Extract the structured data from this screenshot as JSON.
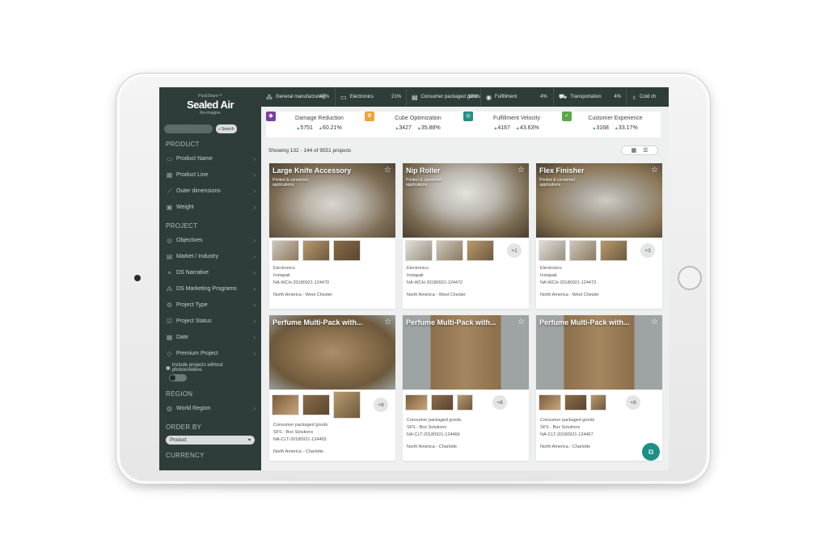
{
  "sidebar": {
    "logo_top": "PackShare™",
    "logo_brand": "Sealed Air",
    "logo_sub": "Re-imagine",
    "search_placeholder": "Search Project",
    "search_button": "Search",
    "sections": {
      "product": "PRODUCT",
      "project": "PROJECT",
      "region": "REGION",
      "order_by": "ORDER BY",
      "currency": "CURRENCY"
    },
    "product_items": [
      "Product Name",
      "Product Line",
      "Outer dimensions",
      "Weight"
    ],
    "project_items": [
      "Objectives",
      "Market / Industry",
      "DS Narrative",
      "DS Marketing Programs",
      "Project Type",
      "Project Status",
      "Date",
      "Premium Project"
    ],
    "toggle_label": "Include projects without photos/videos",
    "region_items": [
      "World Region"
    ],
    "order_by_value": "Product"
  },
  "categories": [
    {
      "icon": "network-icon",
      "label": "General manufacturing",
      "pct": "47%"
    },
    {
      "icon": "monitor-icon",
      "label": "Electronics",
      "pct": "21%"
    },
    {
      "icon": "box-icon",
      "label": "Consumer packaged goods",
      "pct": "10%"
    },
    {
      "icon": "eye-icon",
      "label": "Fulfillment",
      "pct": "4%"
    },
    {
      "icon": "truck-icon",
      "label": "Transportation",
      "pct": "4%"
    },
    {
      "icon": "bulb-icon",
      "label": "Cold ch",
      "pct": ""
    }
  ],
  "kpis": [
    {
      "title": "Damage Reduction",
      "count": "5751",
      "pct": "60.21%",
      "color": "#7b3fa0"
    },
    {
      "title": "Cube Optimization",
      "count": "3427",
      "pct": "35.88%",
      "color": "#f2a23a"
    },
    {
      "title": "Fulfillment Velocity",
      "count": "4167",
      "pct": "43.63%",
      "color": "#1f8f84"
    },
    {
      "title": "Customer Experience",
      "count": "3168",
      "pct": "33.17%",
      "color": "#5aa845"
    }
  ],
  "showing_text": "Showing 132 - 144 of 9551 projects",
  "cards": [
    {
      "title": "Large Knife Accessory",
      "subtitle": "Printed & converted applications",
      "more": "",
      "market": "Electronics",
      "product": "Instapak",
      "code": "NA-WCH-20180921-124470",
      "region": "North America - West Chester"
    },
    {
      "title": "Nip Roller",
      "subtitle": "Printed & converted applications",
      "more": "+1",
      "market": "Electronics",
      "product": "Instapak",
      "code": "NA-WCH-20180921-124472",
      "region": "North America - West Chester"
    },
    {
      "title": "Flex Finisher",
      "subtitle": "Printed & converted applications",
      "more": "+3",
      "market": "Electronics",
      "product": "Instapak",
      "code": "NA-WCH-20180921-124473",
      "region": "North America - West Chester"
    },
    {
      "title": "Perfume Multi-Pack with...",
      "subtitle": "",
      "more": "+8",
      "market": "Consumer packaged goods",
      "product": "SFS - Box Solutions",
      "code": "NA-CLT-20180921-124465",
      "region": "North America - Charlotte"
    },
    {
      "title": "Perfume Multi-Pack with...",
      "subtitle": "",
      "more": "+8",
      "market": "Consumer packaged goods",
      "product": "SFS - Box Solutions",
      "code": "NA-CLT-20180921-124466",
      "region": "North America - Charlotte"
    },
    {
      "title": "Perfume Multi-Pack with...",
      "subtitle": "",
      "more": "+8",
      "market": "Consumer packaged goods",
      "product": "SFS - Box Solutions",
      "code": "NA-CLT-20180921-124467",
      "region": "North America - Charlotte"
    }
  ]
}
